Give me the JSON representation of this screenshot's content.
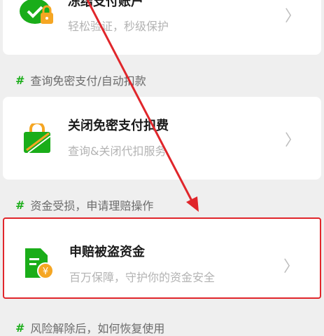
{
  "card_top": {
    "title": "冻结支付账户",
    "subtitle": "轻松验证，秒级保护"
  },
  "section_1": {
    "hash": "#",
    "label": "查询免密支付/自动扣款"
  },
  "card_mid": {
    "title": "关闭免密支付扣费",
    "subtitle": "查询&关闭代扣服务"
  },
  "section_2": {
    "hash": "#",
    "label": "资金受损，申请理赔操作"
  },
  "card_hl": {
    "title": "申赔被盗资金",
    "subtitle": "百万保障，守护你的资金安全"
  },
  "section_3": {
    "hash": "#",
    "label": "风险解除后，如何恢复使用"
  },
  "chevron": "〉",
  "colors": {
    "accent": "#1aad19",
    "annotation_red": "#e0262b",
    "icon_orange": "#f5a623"
  },
  "icons": [
    "shield-lock-icon",
    "bag-no-icon",
    "document-yen-icon",
    "chevron-right-icon"
  ]
}
